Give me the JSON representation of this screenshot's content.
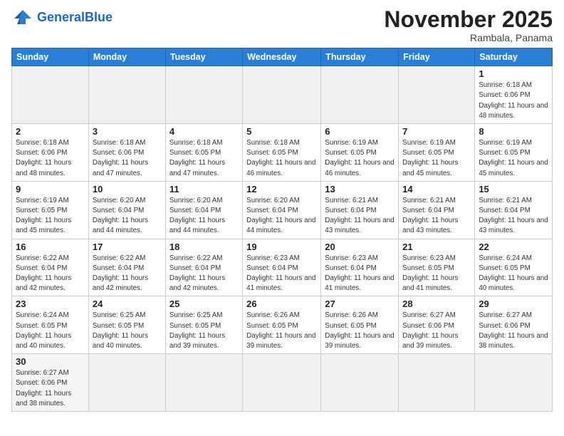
{
  "header": {
    "logo_general": "General",
    "logo_blue": "Blue",
    "month_title": "November 2025",
    "subtitle": "Rambala, Panama"
  },
  "days_of_week": [
    "Sunday",
    "Monday",
    "Tuesday",
    "Wednesday",
    "Thursday",
    "Friday",
    "Saturday"
  ],
  "weeks": [
    [
      {
        "day": "",
        "info": ""
      },
      {
        "day": "",
        "info": ""
      },
      {
        "day": "",
        "info": ""
      },
      {
        "day": "",
        "info": ""
      },
      {
        "day": "",
        "info": ""
      },
      {
        "day": "",
        "info": ""
      },
      {
        "day": "1",
        "info": "Sunrise: 6:18 AM\nSunset: 6:06 PM\nDaylight: 11 hours\nand 48 minutes."
      }
    ],
    [
      {
        "day": "2",
        "info": "Sunrise: 6:18 AM\nSunset: 6:06 PM\nDaylight: 11 hours\nand 48 minutes."
      },
      {
        "day": "3",
        "info": "Sunrise: 6:18 AM\nSunset: 6:06 PM\nDaylight: 11 hours\nand 47 minutes."
      },
      {
        "day": "4",
        "info": "Sunrise: 6:18 AM\nSunset: 6:05 PM\nDaylight: 11 hours\nand 47 minutes."
      },
      {
        "day": "5",
        "info": "Sunrise: 6:18 AM\nSunset: 6:05 PM\nDaylight: 11 hours\nand 46 minutes."
      },
      {
        "day": "6",
        "info": "Sunrise: 6:19 AM\nSunset: 6:05 PM\nDaylight: 11 hours\nand 46 minutes."
      },
      {
        "day": "7",
        "info": "Sunrise: 6:19 AM\nSunset: 6:05 PM\nDaylight: 11 hours\nand 45 minutes."
      },
      {
        "day": "8",
        "info": "Sunrise: 6:19 AM\nSunset: 6:05 PM\nDaylight: 11 hours\nand 45 minutes."
      }
    ],
    [
      {
        "day": "9",
        "info": "Sunrise: 6:19 AM\nSunset: 6:05 PM\nDaylight: 11 hours\nand 45 minutes."
      },
      {
        "day": "10",
        "info": "Sunrise: 6:20 AM\nSunset: 6:04 PM\nDaylight: 11 hours\nand 44 minutes."
      },
      {
        "day": "11",
        "info": "Sunrise: 6:20 AM\nSunset: 6:04 PM\nDaylight: 11 hours\nand 44 minutes."
      },
      {
        "day": "12",
        "info": "Sunrise: 6:20 AM\nSunset: 6:04 PM\nDaylight: 11 hours\nand 44 minutes."
      },
      {
        "day": "13",
        "info": "Sunrise: 6:21 AM\nSunset: 6:04 PM\nDaylight: 11 hours\nand 43 minutes."
      },
      {
        "day": "14",
        "info": "Sunrise: 6:21 AM\nSunset: 6:04 PM\nDaylight: 11 hours\nand 43 minutes."
      },
      {
        "day": "15",
        "info": "Sunrise: 6:21 AM\nSunset: 6:04 PM\nDaylight: 11 hours\nand 43 minutes."
      }
    ],
    [
      {
        "day": "16",
        "info": "Sunrise: 6:22 AM\nSunset: 6:04 PM\nDaylight: 11 hours\nand 42 minutes."
      },
      {
        "day": "17",
        "info": "Sunrise: 6:22 AM\nSunset: 6:04 PM\nDaylight: 11 hours\nand 42 minutes."
      },
      {
        "day": "18",
        "info": "Sunrise: 6:22 AM\nSunset: 6:04 PM\nDaylight: 11 hours\nand 42 minutes."
      },
      {
        "day": "19",
        "info": "Sunrise: 6:23 AM\nSunset: 6:04 PM\nDaylight: 11 hours\nand 41 minutes."
      },
      {
        "day": "20",
        "info": "Sunrise: 6:23 AM\nSunset: 6:04 PM\nDaylight: 11 hours\nand 41 minutes."
      },
      {
        "day": "21",
        "info": "Sunrise: 6:23 AM\nSunset: 6:05 PM\nDaylight: 11 hours\nand 41 minutes."
      },
      {
        "day": "22",
        "info": "Sunrise: 6:24 AM\nSunset: 6:05 PM\nDaylight: 11 hours\nand 40 minutes."
      }
    ],
    [
      {
        "day": "23",
        "info": "Sunrise: 6:24 AM\nSunset: 6:05 PM\nDaylight: 11 hours\nand 40 minutes."
      },
      {
        "day": "24",
        "info": "Sunrise: 6:25 AM\nSunset: 6:05 PM\nDaylight: 11 hours\nand 40 minutes."
      },
      {
        "day": "25",
        "info": "Sunrise: 6:25 AM\nSunset: 6:05 PM\nDaylight: 11 hours\nand 39 minutes."
      },
      {
        "day": "26",
        "info": "Sunrise: 6:26 AM\nSunset: 6:05 PM\nDaylight: 11 hours\nand 39 minutes."
      },
      {
        "day": "27",
        "info": "Sunrise: 6:26 AM\nSunset: 6:05 PM\nDaylight: 11 hours\nand 39 minutes."
      },
      {
        "day": "28",
        "info": "Sunrise: 6:27 AM\nSunset: 6:06 PM\nDaylight: 11 hours\nand 39 minutes."
      },
      {
        "day": "29",
        "info": "Sunrise: 6:27 AM\nSunset: 6:06 PM\nDaylight: 11 hours\nand 38 minutes."
      }
    ],
    [
      {
        "day": "30",
        "info": "Sunrise: 6:27 AM\nSunset: 6:06 PM\nDaylight: 11 hours\nand 38 minutes."
      },
      {
        "day": "",
        "info": ""
      },
      {
        "day": "",
        "info": ""
      },
      {
        "day": "",
        "info": ""
      },
      {
        "day": "",
        "info": ""
      },
      {
        "day": "",
        "info": ""
      },
      {
        "day": "",
        "info": ""
      }
    ]
  ]
}
